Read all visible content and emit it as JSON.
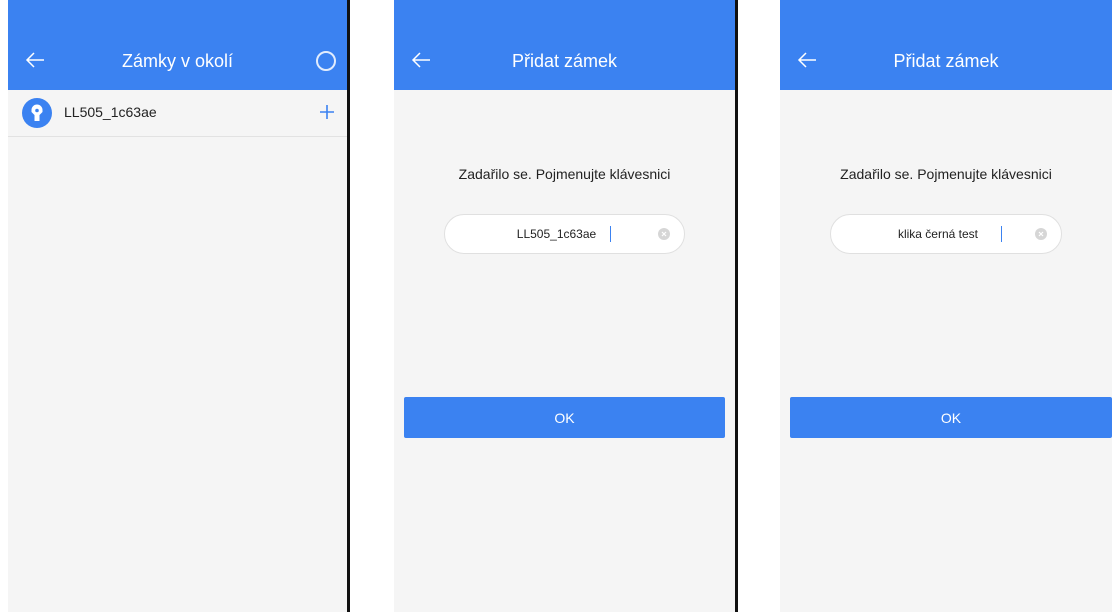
{
  "colors": {
    "accent": "#3b82f1",
    "background": "#f5f5f5",
    "text": "#222222"
  },
  "screen1": {
    "title": "Zámky v okolí",
    "icons": {
      "back": "back-arrow-icon",
      "status": "scanning-circle-icon"
    },
    "locks": [
      {
        "name": "LL505_1c63ae",
        "icon": "lock-icon",
        "action_icon": "plus-icon"
      }
    ]
  },
  "screen2": {
    "title": "Přidat zámek",
    "message": "Zadařilo se. Pojmenujte klávesnici",
    "input_value": "LL505_1c63ae",
    "ok_label": "OK"
  },
  "screen3": {
    "title": "Přidat zámek",
    "message": "Zadařilo se. Pojmenujte klávesnici",
    "input_value": "klika černá test",
    "ok_label": "OK"
  }
}
